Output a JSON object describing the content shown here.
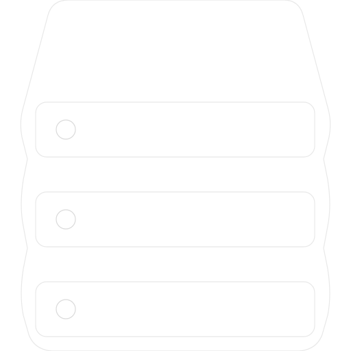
{
  "icon": {
    "name": "server-stack-icon",
    "drive_count": 3,
    "colors": {
      "background": "#ffffff",
      "body_fill": "#ffffff",
      "outline": "#e8e8e8",
      "led_outline": "#dadada"
    }
  }
}
